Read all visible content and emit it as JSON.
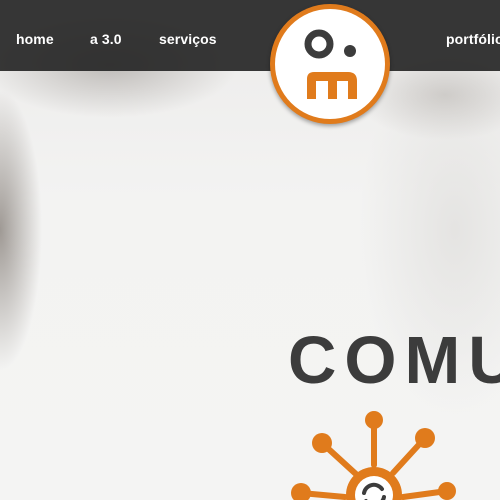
{
  "nav": {
    "items": [
      {
        "label": "home"
      },
      {
        "label": "a 3.0"
      },
      {
        "label": "serviços"
      },
      {
        "label": "portfólio"
      }
    ]
  },
  "logo": {
    "name": "om-logo"
  },
  "hero": {
    "title": "COMU"
  },
  "icons": {
    "logo": "om-logo",
    "hero": "network-hub-icon"
  },
  "colors": {
    "accent": "#e07b1c",
    "navbar": "#2b2b2b",
    "heading": "#3c3c3c",
    "nav_text": "#ffffff",
    "background": "#f2f2f1"
  }
}
